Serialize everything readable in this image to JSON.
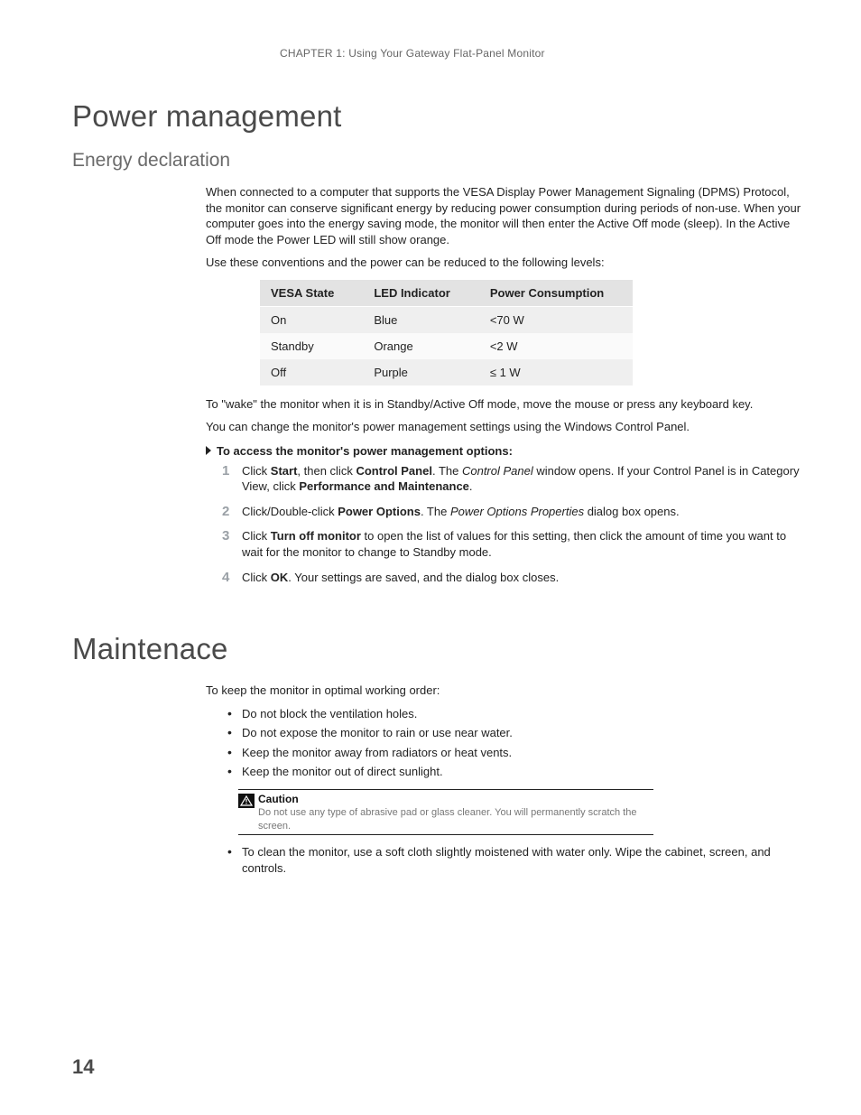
{
  "runningHead": "CHAPTER 1: Using Your Gateway Flat-Panel Monitor",
  "pageNumber": "14",
  "section1": {
    "title": "Power management",
    "sub": {
      "title": "Energy declaration",
      "p1": "When connected to a computer that supports the VESA Display Power Management Signaling (DPMS) Protocol, the monitor can conserve significant energy by reducing power consumption during periods of non-use. When your computer goes into the energy saving mode, the monitor will then enter the Active Off mode (sleep). In the Active Off mode the Power LED will still show orange.",
      "p2": "Use these conventions and the power can be reduced to the following levels:",
      "table": {
        "headers": [
          "VESA State",
          "LED Indicator",
          "Power Consumption"
        ],
        "rows": [
          [
            "On",
            "Blue",
            "<70 W"
          ],
          [
            "Standby",
            "Orange",
            "<2 W"
          ],
          [
            "Off",
            "Purple",
            "≤ 1 W"
          ]
        ]
      },
      "p3": "To \"wake\" the monitor when it is in Standby/Active Off mode, move the mouse or press any keyboard key.",
      "p4": "You can change the monitor's power management settings using the Windows Control Panel.",
      "procHeading": "To access the monitor's power management options:",
      "steps": [
        {
          "num": "1",
          "pre": "Click ",
          "b1": "Start",
          "mid1": ", then click ",
          "b2": "Control Panel",
          "mid2": ". The ",
          "i1": "Control Panel",
          "mid3": " window opens. If your Control Panel is in Category View, click ",
          "b3": "Performance and Maintenance",
          "tail": "."
        },
        {
          "num": "2",
          "pre": "Click/Double-click ",
          "b1": "Power Options",
          "mid1": ". The ",
          "i1": "Power Options Properties",
          "tail": " dialog box opens."
        },
        {
          "num": "3",
          "pre": "Click ",
          "b1": "Turn off monitor",
          "tail": " to open the list of values for this setting, then click the amount of time you want to wait for the monitor to change to Standby mode."
        },
        {
          "num": "4",
          "pre": "Click ",
          "b1": "OK",
          "tail": ". Your settings are saved, and the dialog box closes."
        }
      ]
    }
  },
  "section2": {
    "title": "Maintenace",
    "p1": "To keep the monitor in optimal working order:",
    "bullets1": [
      "Do not block the ventilation holes.",
      "Do not expose the monitor to rain or use near water.",
      "Keep the monitor away from radiators or heat vents.",
      "Keep the monitor out of direct sunlight."
    ],
    "caution": {
      "label": "Caution",
      "text": "Do not use any type of abrasive pad or glass cleaner. You will permanently scratch the screen."
    },
    "bullets2": [
      "To clean the monitor, use a soft cloth slightly moistened with water only. Wipe the cabinet, screen, and controls."
    ]
  }
}
